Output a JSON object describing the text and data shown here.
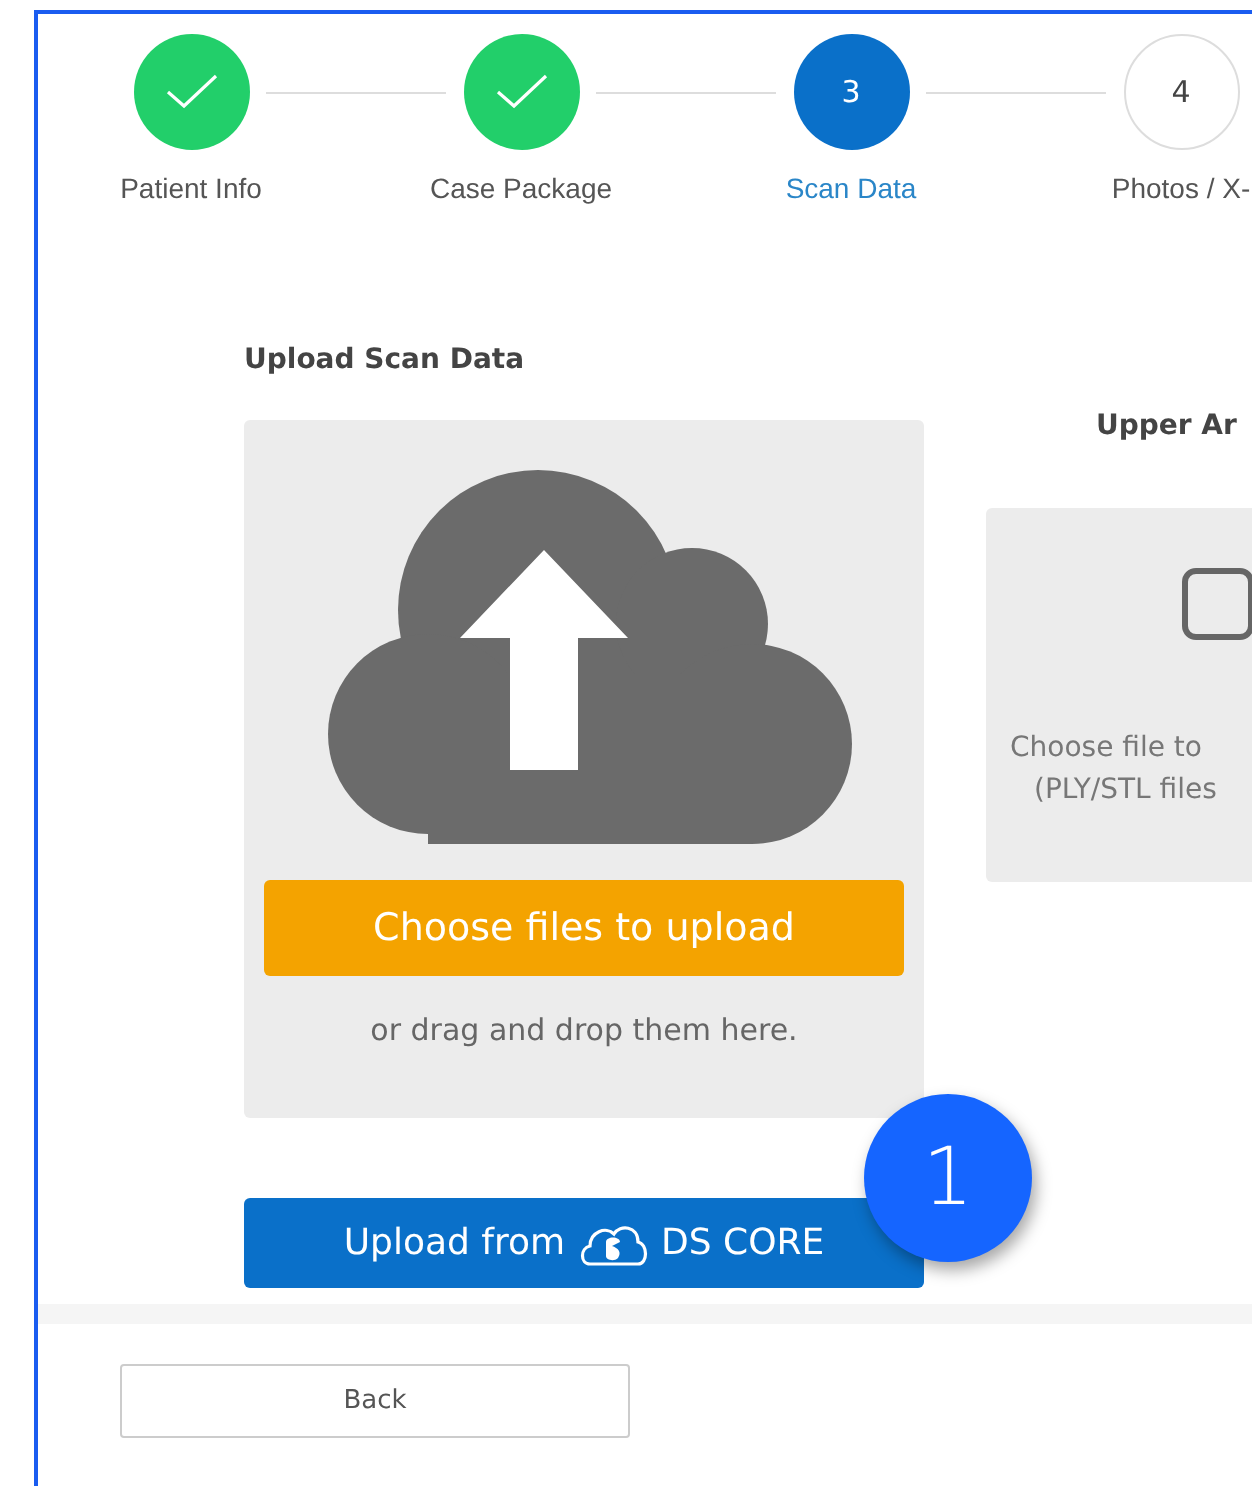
{
  "steps": [
    {
      "label": "Patient Info",
      "completed": true,
      "selected": false
    },
    {
      "label": "Case Package",
      "completed": true,
      "selected": false
    },
    {
      "label": "Scan Data",
      "number": "3",
      "completed": false,
      "selected": true
    },
    {
      "label": "Photos / X-",
      "number": "4",
      "completed": false,
      "selected": false
    }
  ],
  "upload": {
    "heading": "Upload Scan Data",
    "choose_button": "Choose files to upload",
    "drop_hint": "or drag and drop them here.",
    "ds_core_button": {
      "before": "Upload from",
      "after": "DS CORE"
    }
  },
  "upper_arch": {
    "heading": "Upper Ar",
    "hint_lines": [
      "Choose file to",
      "(PLY/STL files"
    ],
    "checked": false
  },
  "callout": "1",
  "footer": {
    "back_button": "Back"
  }
}
